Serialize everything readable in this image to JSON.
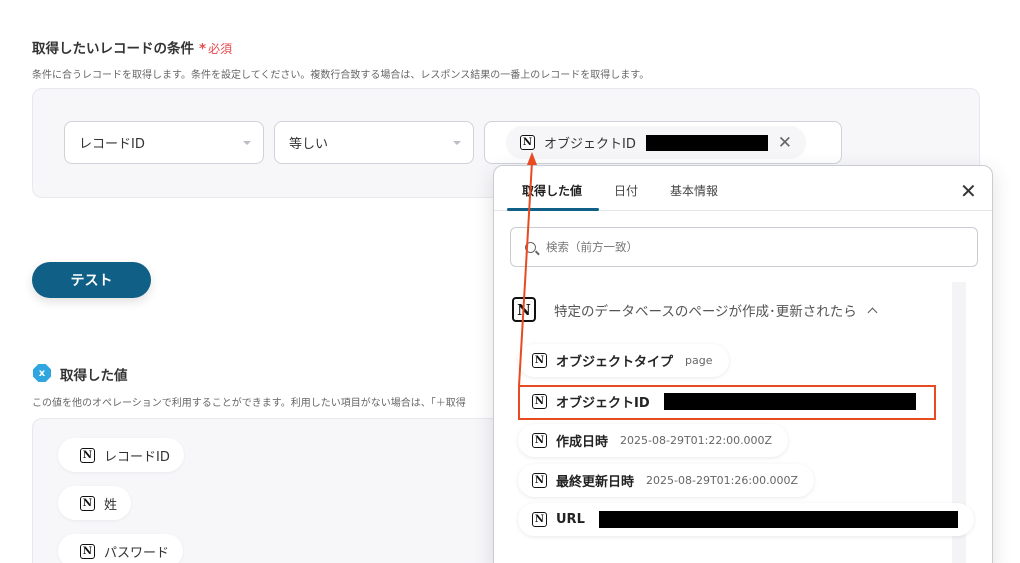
{
  "conditions": {
    "title": "取得したいレコードの条件",
    "required_star": "*",
    "required_text": "必須",
    "description": "条件に合うレコードを取得します。条件を設定してください。複数行合致する場合は、レスポンス結果の一番上のレコードを取得します。",
    "field_select": "レコードID",
    "operator_select": "等しい",
    "value_chip_label": "オブジェクトID"
  },
  "test_button": "テスト",
  "acquired": {
    "icon_letter": "x",
    "title": "取得した値",
    "description": "この値を他のオペレーションで利用することができます。利用したい項目がない場合は、「＋取得",
    "chips": [
      "レコードID",
      "姓",
      "パスワード"
    ]
  },
  "dropdown": {
    "tabs": [
      "取得した値",
      "日付",
      "基本情報"
    ],
    "search_placeholder": "検索（前方一致）",
    "group_title": "特定のデータベースのページが作成･更新されたら",
    "items": [
      {
        "label": "オブジェクトタイプ",
        "value": "page"
      },
      {
        "label": "オブジェクトID",
        "value": ""
      },
      {
        "label": "作成日時",
        "value": "2025-08-29T01:22:00.000Z"
      },
      {
        "label": "最終更新日時",
        "value": "2025-08-29T01:26:00.000Z"
      },
      {
        "label": "URL",
        "value": ""
      }
    ]
  },
  "icons": {
    "notion_letter": "N",
    "close": "✕",
    "chip_remove": "✕"
  },
  "colors": {
    "primary": "#0f5f86",
    "required": "#e5484d",
    "highlight": "#e84a22",
    "acquired_icon": "#2fa6e0"
  }
}
